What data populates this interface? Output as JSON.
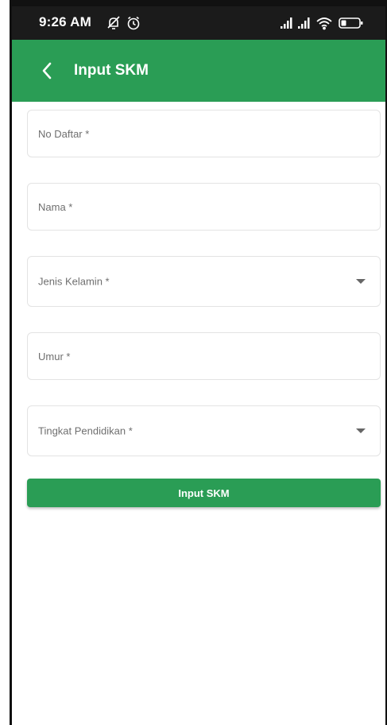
{
  "status_bar": {
    "time": "9:26 AM",
    "icons_left": [
      "notifications-off-icon",
      "alarm-icon"
    ],
    "icons_right": [
      "signal-icon",
      "signal-icon",
      "wifi-icon",
      "battery-icon"
    ]
  },
  "app_bar": {
    "back_icon": "chevron-left-icon",
    "title": "Input SKM",
    "color": "#2a9d55"
  },
  "form": {
    "no_daftar": {
      "placeholder": "No Daftar *",
      "value": ""
    },
    "nama": {
      "placeholder": "Nama *",
      "value": ""
    },
    "jenis_kelamin": {
      "label": "Jenis Kelamin *",
      "icon": "dropdown-arrow-icon"
    },
    "umur": {
      "placeholder": "Umur *",
      "value": ""
    },
    "tingkat_pendidikan": {
      "label": "Tingkat Pendidikan *",
      "icon": "dropdown-arrow-icon"
    },
    "submit_label": "Input SKM"
  }
}
